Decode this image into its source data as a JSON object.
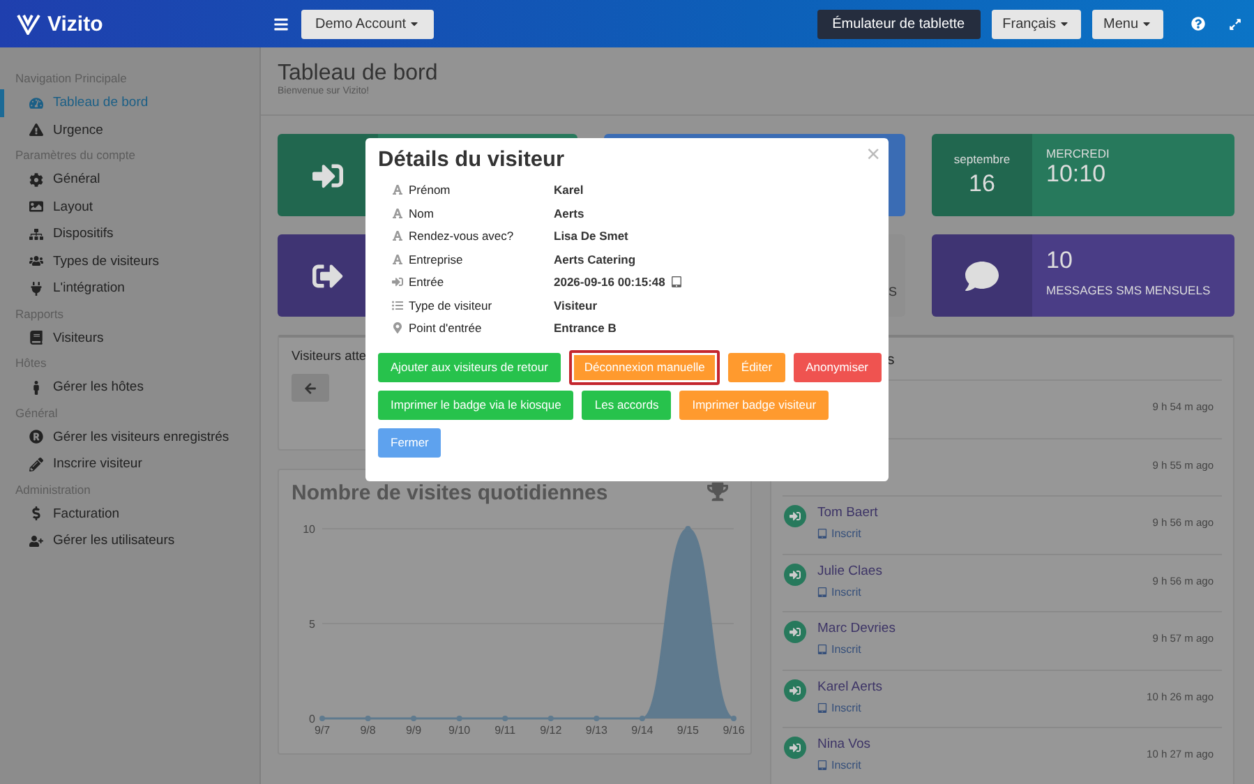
{
  "header": {
    "logo": "Vizito",
    "account": "Demo Account",
    "buttons": [
      {
        "label": "Émulateur de tablette",
        "kind": "dark",
        "caret": false
      },
      {
        "label": "Français",
        "kind": "light",
        "caret": true
      },
      {
        "label": "Menu",
        "kind": "light",
        "caret": true
      }
    ]
  },
  "sidebar": {
    "sections": [
      {
        "heading": "Navigation Principale",
        "items": [
          {
            "label": "Tableau de bord",
            "selected": true
          },
          {
            "label": "Urgence",
            "selected": false
          }
        ]
      },
      {
        "heading": "Paramètres du compte",
        "items": [
          {
            "label": "Général",
            "selected": false
          },
          {
            "label": "Layout",
            "selected": false
          },
          {
            "label": "Dispositifs",
            "selected": false
          },
          {
            "label": "Types de visiteurs",
            "selected": false
          },
          {
            "label": "L'intégration",
            "selected": false
          }
        ]
      },
      {
        "heading": "Rapports",
        "items": [
          {
            "label": "Visiteurs",
            "selected": false
          }
        ]
      },
      {
        "heading": "Hôtes",
        "items": [
          {
            "label": "Gérer les hôtes",
            "selected": false
          }
        ]
      },
      {
        "heading": "Général",
        "items": [
          {
            "label": "Gérer les visiteurs enregistrés",
            "selected": false
          },
          {
            "label": "Inscrire visiteur",
            "selected": false
          }
        ]
      },
      {
        "heading": "Administration",
        "items": [
          {
            "label": "Facturation",
            "selected": false
          },
          {
            "label": "Gérer les utilisateurs",
            "selected": false
          }
        ]
      }
    ]
  },
  "page": {
    "title": "Tableau de bord",
    "subtitle": "Bienvenue sur Vizito!"
  },
  "stat_cards": [
    {
      "kind": "checkin",
      "color": "#27795c"
    },
    {
      "kind": "blank",
      "color": "#3a6cb4"
    },
    {
      "kind": "date",
      "color": "#27795c",
      "month": "septembre",
      "day": "16",
      "weekday": "MERCREDI",
      "time": "10:10"
    },
    {
      "kind": "checkout",
      "color": "#4a3d86"
    },
    {
      "kind": "label",
      "color": "#8f8f8f",
      "label": "S"
    },
    {
      "kind": "sms",
      "color": "#4a3d86",
      "value": "10",
      "label": "MESSAGES SMS MENSUELS"
    }
  ],
  "waiting_panel": {
    "title": "Visiteurs atte"
  },
  "chart_panel": {
    "title": "Nombre de visites quotidiennes",
    "chart_data": {
      "type": "area",
      "categories": [
        "9/7",
        "9/8",
        "9/9",
        "9/10",
        "9/11",
        "9/12",
        "9/13",
        "9/14",
        "9/15",
        "9/16"
      ],
      "series": [
        {
          "color": "#5f7a8e",
          "values": [
            0,
            0,
            0,
            0,
            0,
            0,
            0,
            0,
            10,
            0
          ]
        }
      ],
      "ylim": [
        0,
        10
      ],
      "yticks": [
        0,
        5,
        10
      ]
    }
  },
  "activity_panel": {
    "title": "s",
    "rows": [
      {
        "time": "9 h 54 m ago"
      },
      {
        "time": "9 h 55 m ago"
      },
      {
        "name": "Tom Baert",
        "status": "Inscrit",
        "time": "9 h 56 m ago"
      },
      {
        "name": "Julie Claes",
        "status": "Inscrit",
        "time": "9 h 56 m ago"
      },
      {
        "name": "Marc Devries",
        "status": "Inscrit",
        "time": "9 h 57 m ago"
      },
      {
        "name": "Karel Aerts",
        "status": "Inscrit",
        "time": "10 h 26 m ago"
      },
      {
        "name": "Nina Vos",
        "status": "Inscrit",
        "time": "10 h 27 m ago"
      }
    ]
  },
  "modal": {
    "title": "Détails du visiteur",
    "close": "×",
    "fields": [
      {
        "kind": "text",
        "label": "Prénom",
        "value": "Karel"
      },
      {
        "kind": "text",
        "label": "Nom",
        "value": "Aerts"
      },
      {
        "kind": "text",
        "label": "Rendez-vous avec?",
        "value": "Lisa De Smet"
      },
      {
        "kind": "text",
        "label": "Entreprise",
        "value": "Aerts Catering"
      },
      {
        "kind": "entry",
        "label": "Entrée",
        "value": "2026-09-16 00:15:48"
      },
      {
        "kind": "list",
        "label": "Type de visiteur",
        "value": "Visiteur"
      },
      {
        "kind": "location",
        "label": "Point d'entrée",
        "value": "Entrance B"
      }
    ],
    "button_rows": [
      [
        {
          "label": "Ajouter aux visiteurs de retour",
          "kind": "success",
          "focused": false
        },
        {
          "label": "Déconnexion manuelle",
          "kind": "warning",
          "focused": true
        },
        {
          "label": "Éditer",
          "kind": "warning",
          "focused": false
        },
        {
          "label": "Anonymiser",
          "kind": "danger",
          "focused": false
        }
      ],
      [
        {
          "label": "Imprimer le badge via le kiosque",
          "kind": "success",
          "focused": false
        },
        {
          "label": "Les accords",
          "kind": "success",
          "focused": false
        },
        {
          "label": "Imprimer badge visiteur",
          "kind": "warning",
          "focused": false
        }
      ],
      [
        {
          "label": "Fermer",
          "kind": "primary",
          "focused": false
        }
      ]
    ]
  }
}
